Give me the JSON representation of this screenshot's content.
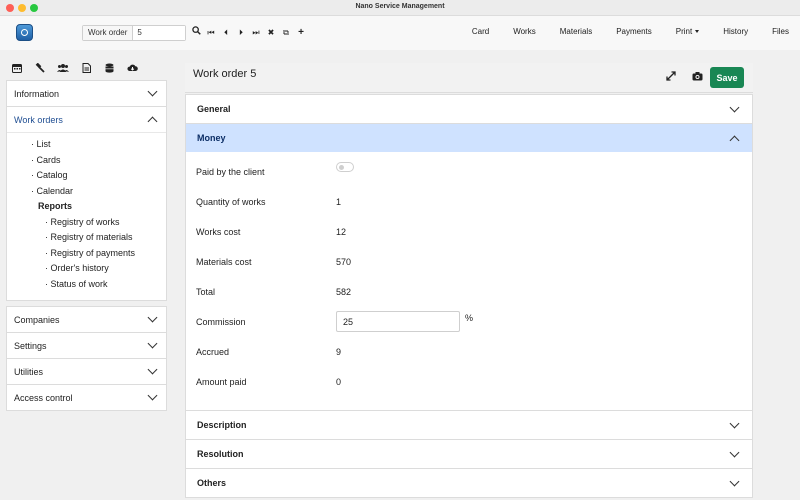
{
  "window": {
    "title": "Nano Service Management"
  },
  "toolbar": {
    "work_order_label": "Work order",
    "work_order_value": "5",
    "nav_icons": [
      "search-icon",
      "first-icon",
      "prev-icon",
      "next-icon",
      "last-icon",
      "close-icon",
      "copy-icon",
      "plus-icon"
    ],
    "menu": [
      "Card",
      "Works",
      "Materials",
      "Payments",
      "Print",
      "History",
      "Files"
    ]
  },
  "sidebar": {
    "icons": [
      "calendar-icon",
      "hammer-icon",
      "users-icon",
      "document-icon",
      "database-icon",
      "cloud-download-icon"
    ],
    "sections": [
      {
        "label": "Information"
      },
      {
        "label": "Work orders"
      },
      {
        "label": "Companies"
      },
      {
        "label": "Settings"
      },
      {
        "label": "Utilities"
      },
      {
        "label": "Access control"
      }
    ],
    "work_orders_items": [
      "· List",
      "· Cards",
      "· Catalog",
      "· Calendar"
    ],
    "reports_heading": "Reports",
    "reports_items": [
      "· Registry of works",
      "· Registry of materials",
      "· Registry of payments",
      "· Order's history",
      "· Status of work"
    ]
  },
  "main": {
    "title": "Work order 5",
    "save_label": "Save",
    "sections": {
      "general": "General",
      "money": "Money",
      "description": "Description",
      "resolution": "Resolution",
      "others": "Others"
    },
    "money": {
      "paid_by_client_label": "Paid by the client",
      "paid_by_client": false,
      "quantity_of_works_label": "Quantity of works",
      "quantity_of_works": "1",
      "works_cost_label": "Works cost",
      "works_cost": "12",
      "materials_cost_label": "Materials cost",
      "materials_cost": "570",
      "total_label": "Total",
      "total": "582",
      "commission_label": "Commission",
      "commission": "25",
      "commission_unit": "%",
      "accrued_label": "Accrued",
      "accrued": "9",
      "amount_paid_label": "Amount paid",
      "amount_paid": "0"
    }
  },
  "colors": {
    "save": "#198754",
    "active_section": "#cfe2ff",
    "active_text": "#1f4e92"
  }
}
